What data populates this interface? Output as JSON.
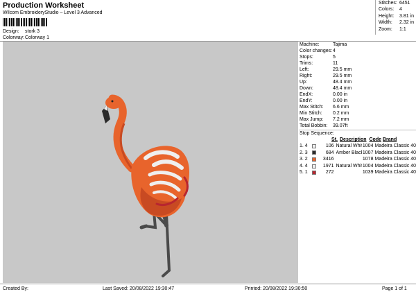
{
  "header": {
    "title": "Production Worksheet",
    "software": "Wilcom EmbroideryStudio – Level 3 Advanced",
    "design_label": "Design:",
    "design_value": "stork 3",
    "colorway_label": "Colorway:",
    "colorway_value": "Colorway 1"
  },
  "stats": [
    {
      "label": "Stitches:",
      "value": "6451"
    },
    {
      "label": "Colors:",
      "value": "4"
    },
    {
      "label": "Height:",
      "value": "3.81 in"
    },
    {
      "label": "Width:",
      "value": "2.32 in"
    },
    {
      "label": "Zoom:",
      "value": "1:1"
    }
  ],
  "machine_info": [
    {
      "label": "Machine:",
      "value": "Tajima"
    },
    {
      "label": "Color changes:",
      "value": "4"
    },
    {
      "label": "Stops:",
      "value": "5"
    },
    {
      "label": "Trims:",
      "value": "11"
    },
    {
      "label": "Left:",
      "value": "29.5 mm"
    },
    {
      "label": "Right:",
      "value": "29.5 mm"
    },
    {
      "label": "Up:",
      "value": "48.4 mm"
    },
    {
      "label": "Down:",
      "value": "48.4 mm"
    },
    {
      "label": "EndX:",
      "value": "0.00 in"
    },
    {
      "label": "EndY:",
      "value": "0.00 in"
    },
    {
      "label": "Max Stitch:",
      "value": "6.6 mm"
    },
    {
      "label": "Min Stitch:",
      "value": "0.2 mm"
    },
    {
      "label": "Max Jump:",
      "value": "7.2 mm"
    },
    {
      "label": "Total Bobbin:",
      "value": "39.07ft"
    }
  ],
  "stop_sequence": {
    "label": "Stop Sequence:",
    "columns": {
      "st": "St.",
      "description": "Description",
      "code": "Code",
      "brand": "Brand"
    },
    "rows": [
      {
        "num": "1.",
        "stop": "4",
        "color": "#efefef",
        "st": "106",
        "description": "Natural White",
        "code": "1004",
        "brand": "Madeira Classic 40"
      },
      {
        "num": "2.",
        "stop": "3",
        "color": "#2b2b2b",
        "st": "684",
        "description": "Amber Black",
        "code": "1007",
        "brand": "Madeira Classic 40"
      },
      {
        "num": "3.",
        "stop": "2",
        "color": "#e8642c",
        "st": "3416",
        "description": "",
        "code": "1078",
        "brand": "Madeira Classic 40"
      },
      {
        "num": "4.",
        "stop": "4",
        "color": "#efefef",
        "st": "1971",
        "description": "Natural White",
        "code": "1004",
        "brand": "Madeira Classic 40"
      },
      {
        "num": "5.",
        "stop": "1",
        "color": "#b8262f",
        "st": "272",
        "description": "",
        "code": "1039",
        "brand": "Madeira Classic 40"
      }
    ]
  },
  "footer": {
    "created_by": "Created By:",
    "last_saved": "Last Saved: 20/08/2022 19:30:47",
    "printed": "Printed: 20/08/2022 19:30:50",
    "page": "Page 1 of 1"
  },
  "colors": {
    "canvas_bg": "#c8c8c8",
    "flamingo_body": "#e8642c",
    "flamingo_shadow": "#c84a22",
    "accent_red": "#b8262f",
    "white_thread": "#efefef",
    "legs": "#4a4a4a"
  }
}
